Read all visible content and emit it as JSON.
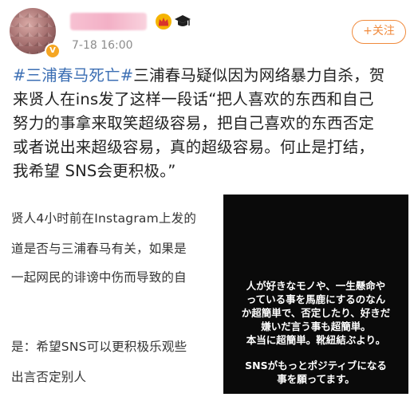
{
  "post": {
    "timestamp": "7-18 16:00",
    "follow_label": "+关注",
    "hashtag": "#三浦春马死亡#",
    "line1_rest": "三浦春马疑似因为网络暴力自杀，贺",
    "line2": "来贤人在ins发了这样一段话“把人喜欢的东西和自己",
    "line3": "努力的事拿来取笑超级容易，把自己喜欢的东西否定",
    "line4": "或者说出来超级容易，真的超级容易。何止是打结，",
    "line5": "我希望 SNS会更积极。”"
  },
  "left_card": {
    "line1": "贤人4小时前在Instagram上发的",
    "line2": "道是否与三浦春马有关，如果是",
    "line3": "一起网民的诽谤中伤而导致的自",
    "line4": "是：希望SNS可以更积极乐观些",
    "line5": "出言否定别人"
  },
  "story": {
    "line1": "人が好きなモノや、一生懸命や",
    "line2": "っている事を馬鹿にするのなん",
    "line3": "か超簡単で、否定したり、好きだ",
    "line4": "嫌いだ言う事も超簡単。",
    "line5": "本当に超簡単。靴紐結ぶより。",
    "line6": "SNSがもっとポジティブになる",
    "line7": "事を願ってます。"
  },
  "colors": {
    "hashtag": "#3c6fb4",
    "follow": "#f08a3c",
    "story_bg": "#0a0a0a"
  },
  "icons": [
    "verified-badge-icon",
    "crown-icon",
    "graduation-cap-icon"
  ]
}
